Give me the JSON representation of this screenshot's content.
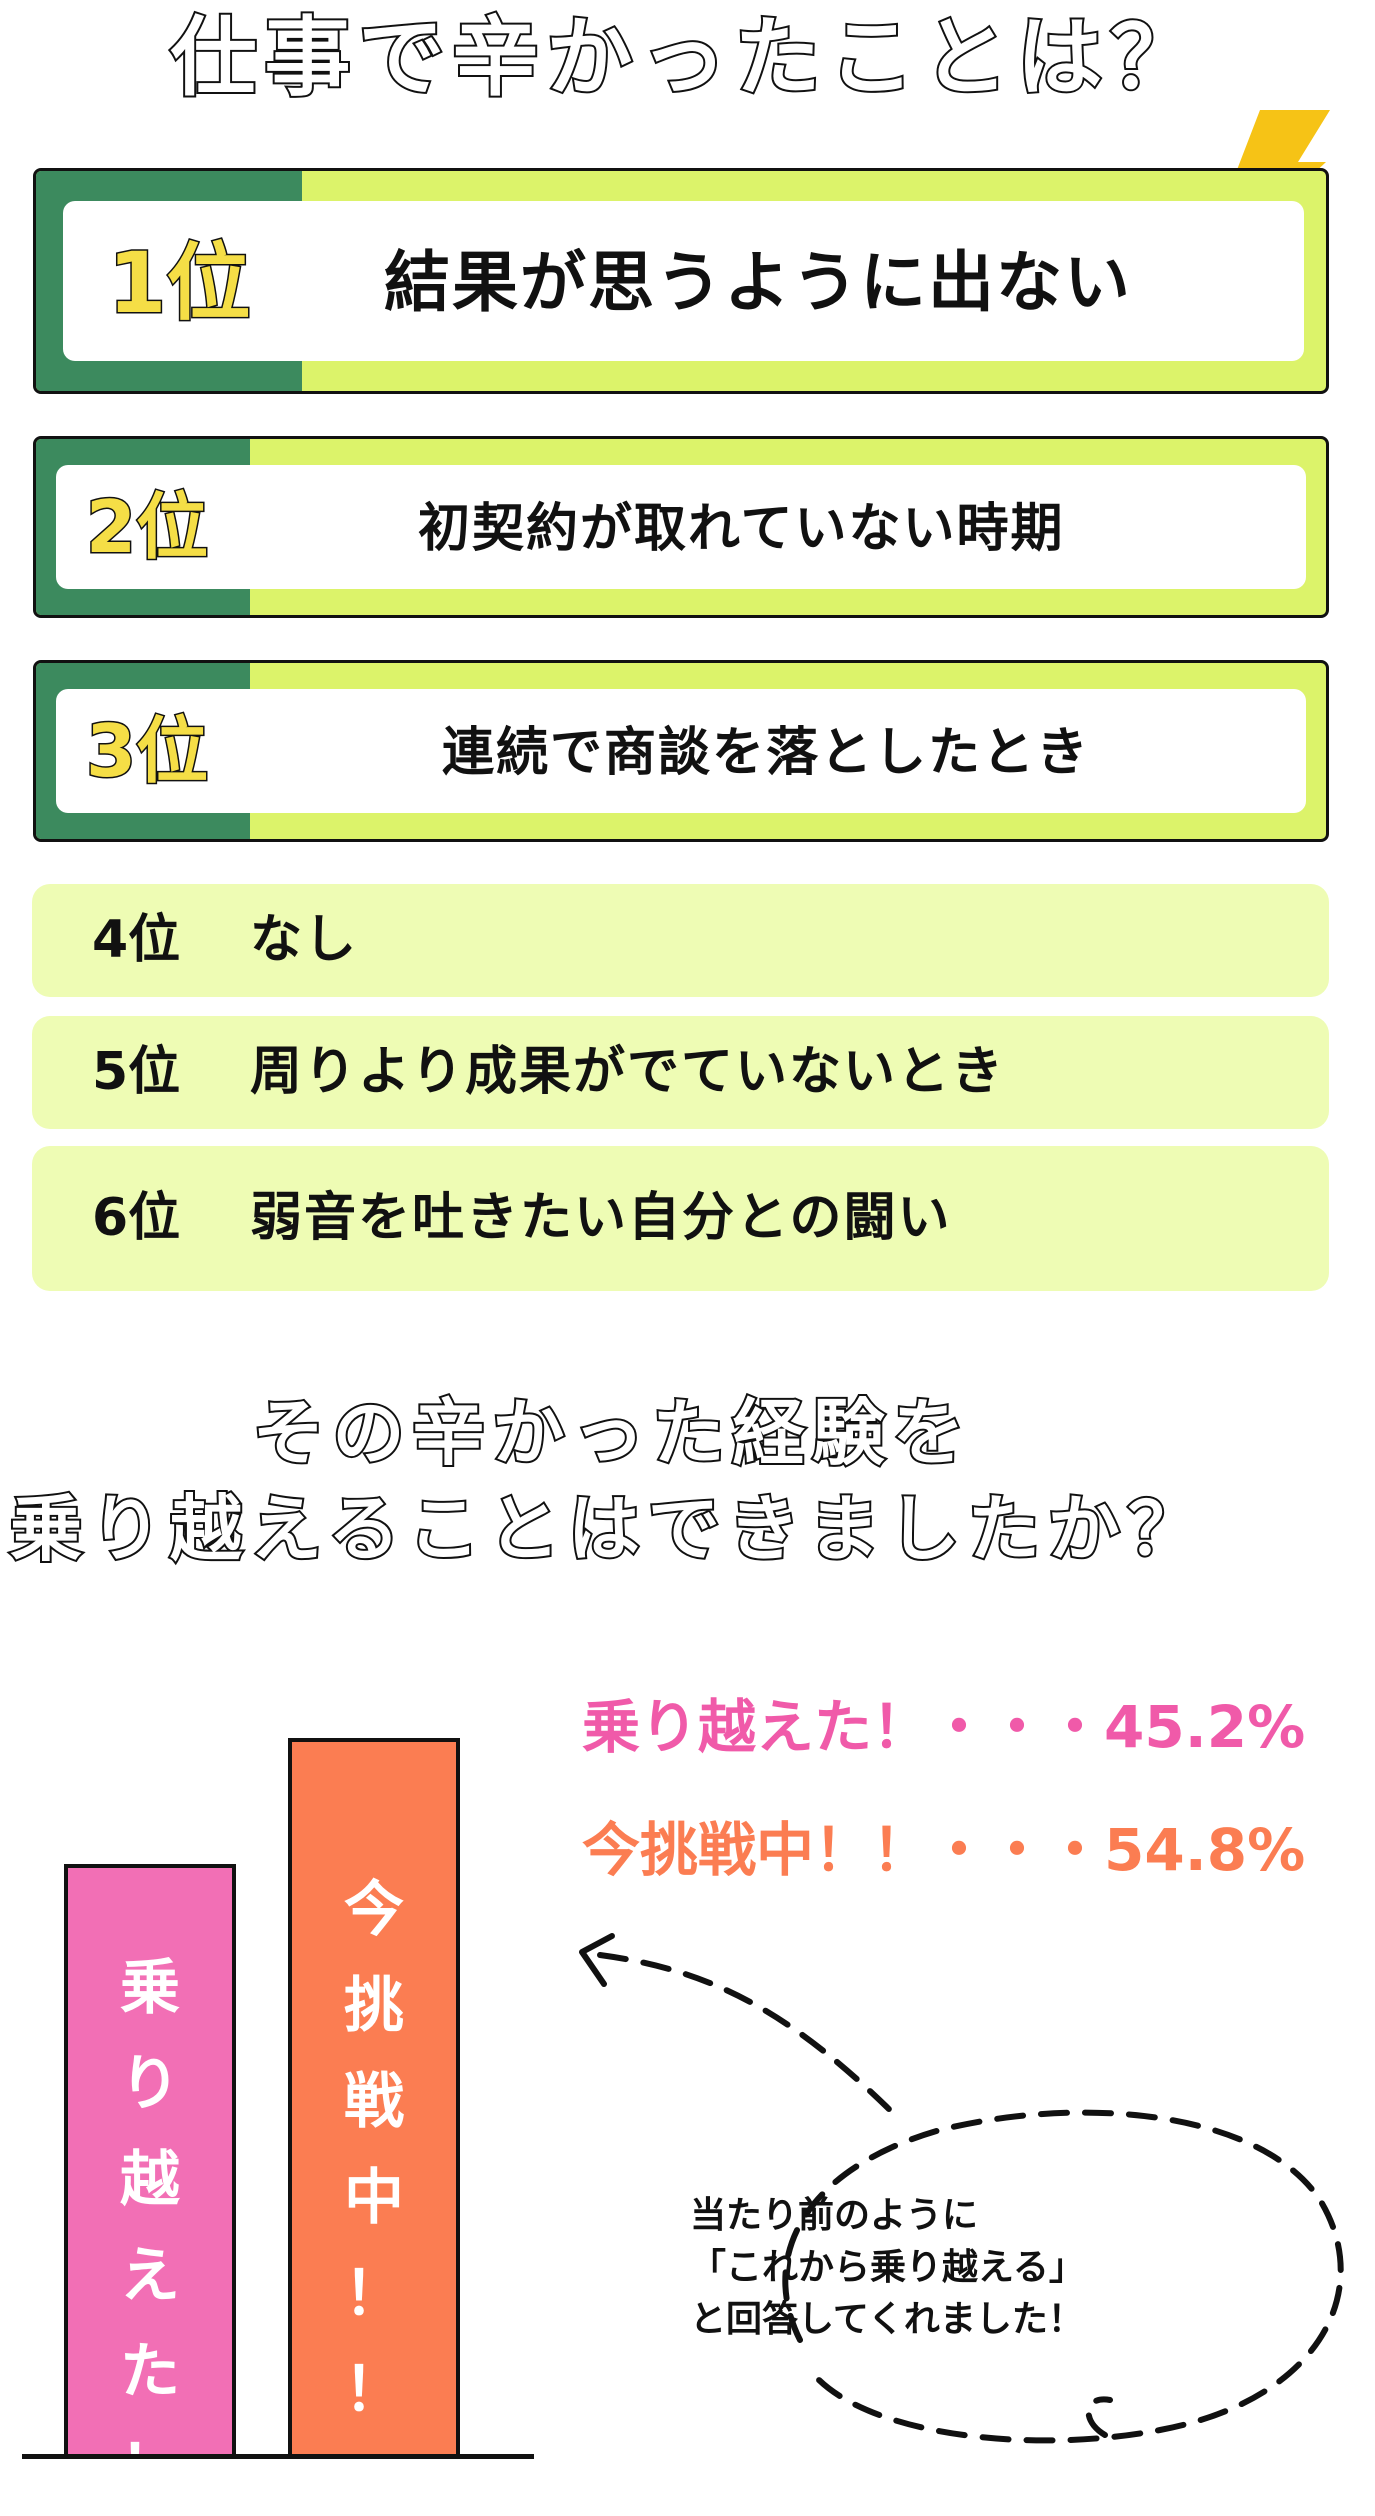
{
  "title_top": "仕事で辛かったことは？",
  "ranks_top": [
    {
      "rank": "1位",
      "text": "結果が思うように出ない"
    },
    {
      "rank": "2位",
      "text": "初契約が取れていない時期"
    },
    {
      "rank": "3位",
      "text": "連続で商談を落としたとき"
    }
  ],
  "ranks_other": [
    {
      "rank": "4位",
      "text": "なし"
    },
    {
      "rank": "5位",
      "text": "周りより成果がでていないとき"
    },
    {
      "rank": "6位",
      "text": "弱音を吐きたい自分との闘い"
    }
  ],
  "title_second": {
    "line1": "その辛かった経験を",
    "line2": "乗り越えることはできましたか？"
  },
  "chart_data": {
    "type": "bar",
    "categories": [
      "乗り越えた！",
      "今挑戦中！！"
    ],
    "values": [
      45.2,
      54.8
    ],
    "unit": "%",
    "colors": [
      "#f26fb5",
      "#fb7d52"
    ],
    "bar_labels": [
      [
        "乗",
        "り",
        "越",
        "え",
        "た",
        "！"
      ],
      [
        "今",
        "挑",
        "戦",
        "中",
        "！",
        "！"
      ]
    ],
    "stats": [
      {
        "label": "乗り越えた！・・・",
        "value": "45.2%",
        "color": "#f05aa9"
      },
      {
        "label": "今挑戦中！！・・・",
        "value": "54.8%",
        "color": "#fb7d52"
      }
    ]
  },
  "bubble": {
    "lines": [
      "当たり前のように",
      "「これから乗り越える」",
      "と回答してくれました！"
    ]
  },
  "colors": {
    "dark_green": "#3c8a5e",
    "lime": "#dcf36a",
    "light_lime": "#eefcb4",
    "gold": "#f5de46",
    "lightning": "#f6c316"
  }
}
